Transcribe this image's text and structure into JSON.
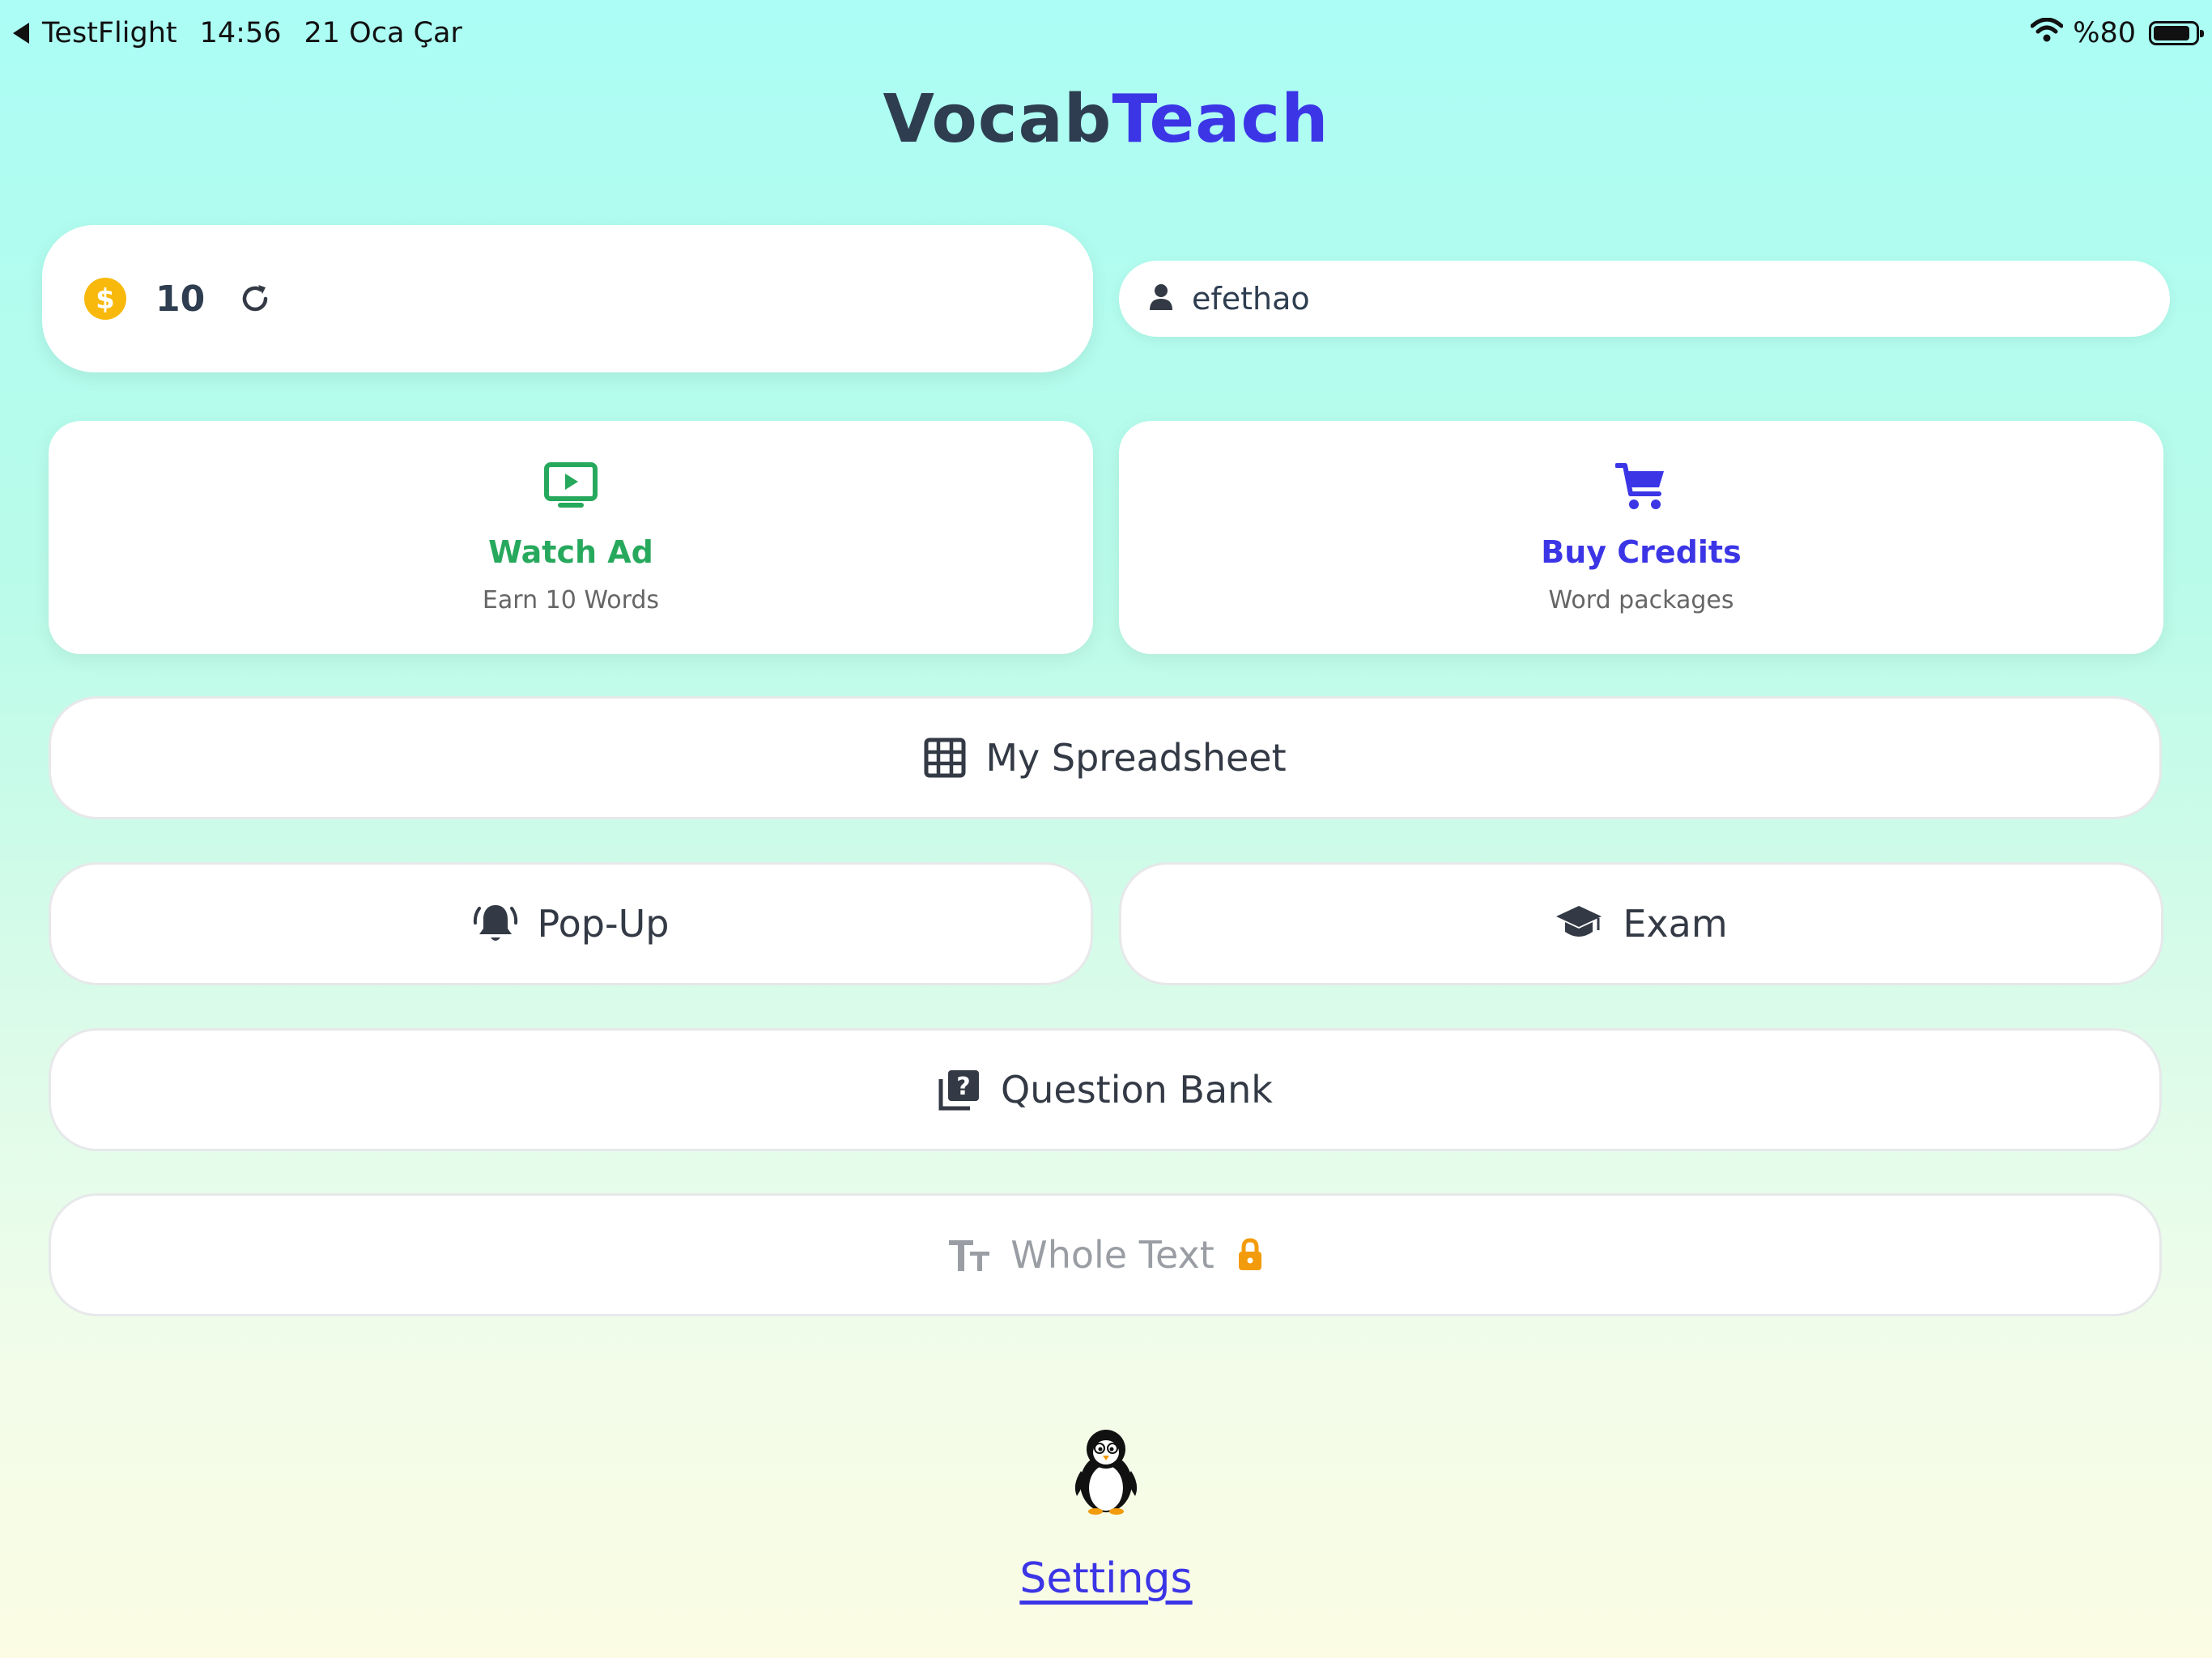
{
  "status_bar": {
    "back_app": "TestFlight",
    "time": "14:56",
    "date": "21 Oca Çar",
    "battery": "%80"
  },
  "header": {
    "title_part1": "Vocab",
    "title_part2": "Teach"
  },
  "credits": {
    "count": "10"
  },
  "user": {
    "name": "efethao"
  },
  "actions": {
    "watch_ad": {
      "title": "Watch Ad",
      "subtitle": "Earn 10 Words"
    },
    "buy_credits": {
      "title": "Buy Credits",
      "subtitle": "Word packages"
    }
  },
  "menu": {
    "spreadsheet": "My Spreadsheet",
    "popup": "Pop-Up",
    "exam": "Exam",
    "question_bank": "Question Bank",
    "whole_text": "Whole Text"
  },
  "footer": {
    "settings": "Settings"
  },
  "colors": {
    "accent_blue": "#3b35e6",
    "accent_green": "#27a95d",
    "coin": "#f8b90c",
    "lock": "#f29b0c",
    "title_dark": "#2e3d50"
  }
}
